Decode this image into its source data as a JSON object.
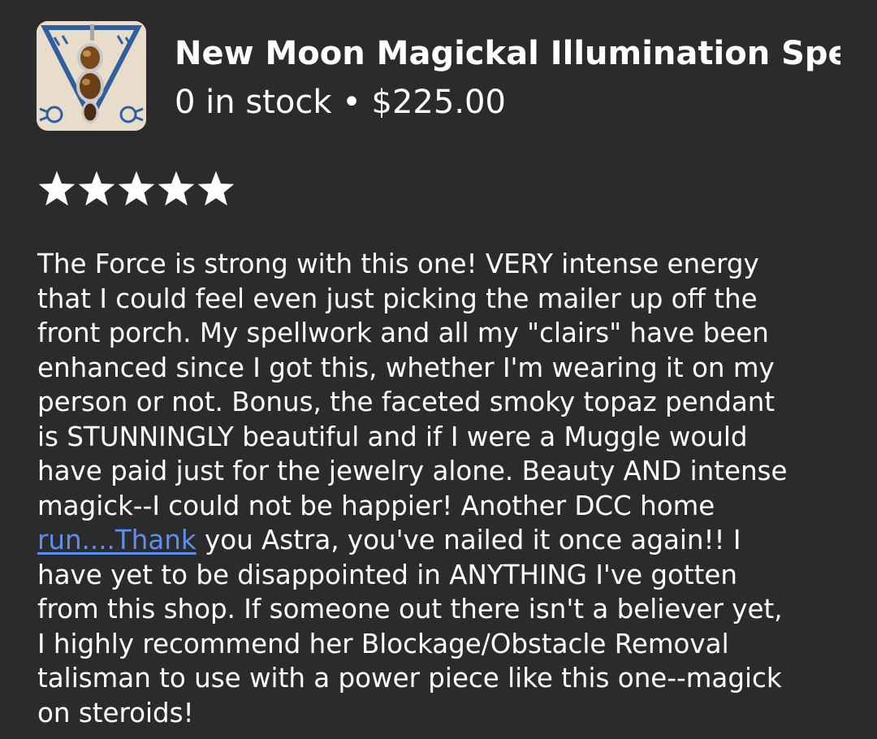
{
  "listing": {
    "title": "New Moon Magickal Illumination Spell...",
    "stock": "0 in stock",
    "separator": "•",
    "price": "$225.00",
    "thumbnail_icon": "pendant-thumbnail-image"
  },
  "rating": {
    "stars": 5,
    "max": 5,
    "star_color": "#ffffff"
  },
  "review": {
    "lines": [
      "The Force is strong with this one! VERY intense energy",
      "that I could feel even just picking the mailer up off the",
      "front porch. My spellwork and all my \"clairs\" have been",
      "enhanced since I got this, whether I'm wearing it on my",
      "person or not. Bonus, the faceted smoky topaz pendant",
      "is STUNNINGLY beautiful and if I were a Muggle would",
      "have paid just for the jewelry alone. Beauty AND intense",
      "magick--I could not be happier! Another DCC home"
    ],
    "link_text": "run....Thank",
    "after_link": " you Astra, you've nailed it once again!! I",
    "lines_after": [
      "have yet to be disappointed in ANYTHING I've gotten",
      "from this shop. If someone out there isn't a believer yet,",
      "I highly recommend her Blockage/Obstacle Removal",
      "talisman to use with a power piece like this one--magick",
      "on steroids!"
    ]
  },
  "colors": {
    "background": "#2b2b2b",
    "text": "#ffffff",
    "link": "#5b8ff0"
  }
}
